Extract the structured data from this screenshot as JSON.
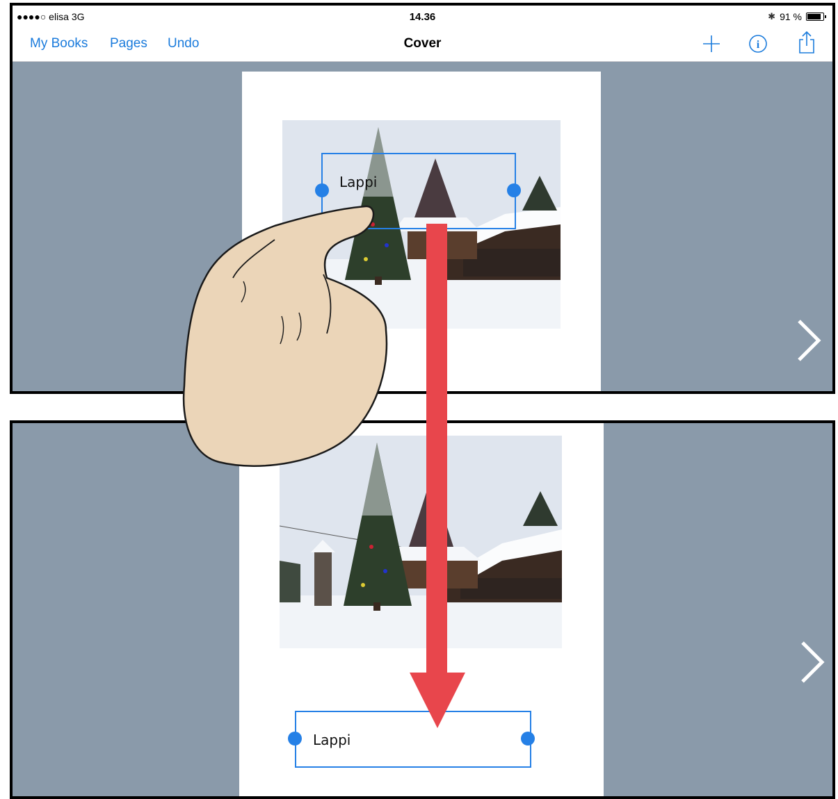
{
  "status": {
    "carrier": "●●●●○ elisa  3G",
    "time": "14.36",
    "battery": "91 %"
  },
  "nav": {
    "my_books": "My Books",
    "pages": "Pages",
    "undo": "Undo",
    "title": "Cover",
    "add_icon": "plus-icon",
    "info_icon": "info-icon",
    "share_icon": "share-icon"
  },
  "top_panel": {
    "textbox_label": "Lappi"
  },
  "bottom_panel": {
    "textbox_label": "Lappi"
  },
  "colors": {
    "accent": "#2580e6",
    "canvas": "#8a9aaa",
    "arrow": "#e8464c"
  }
}
